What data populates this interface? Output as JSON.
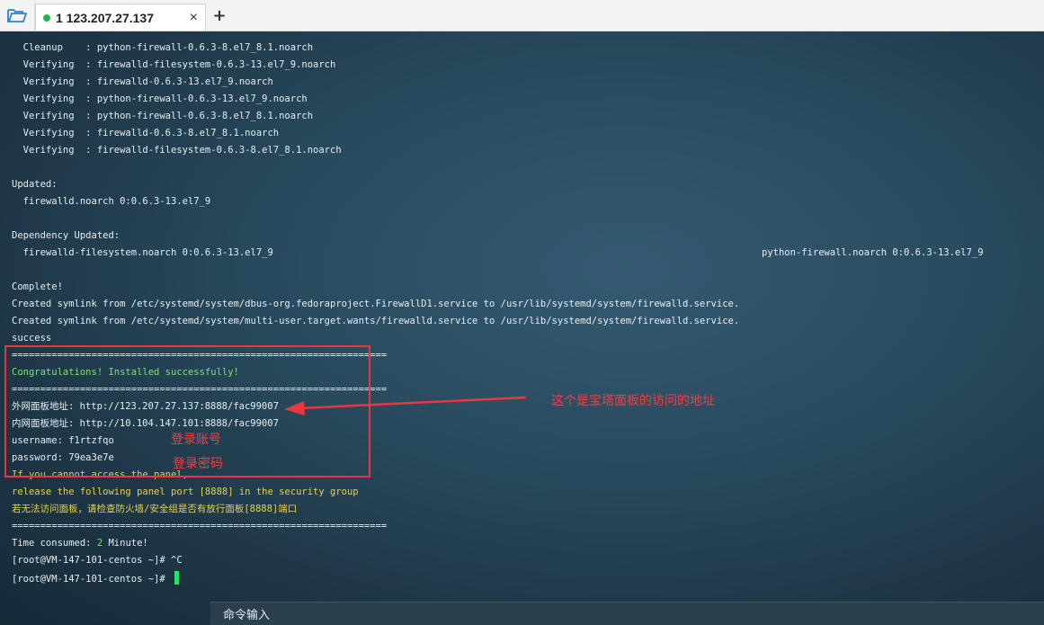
{
  "tabbar": {
    "folder_icon": "folder-open-icon",
    "tab_title": "1 123.207.27.137",
    "tab_close": "×",
    "add_tab": "+"
  },
  "terminal": {
    "lines": [
      "  Cleanup    : python-firewall-0.6.3-8.el7_8.1.noarch",
      "  Verifying  : firewalld-filesystem-0.6.3-13.el7_9.noarch",
      "  Verifying  : firewalld-0.6.3-13.el7_9.noarch",
      "  Verifying  : python-firewall-0.6.3-13.el7_9.noarch",
      "  Verifying  : python-firewall-0.6.3-8.el7_8.1.noarch",
      "  Verifying  : firewalld-0.6.3-8.el7_8.1.noarch",
      "  Verifying  : firewalld-filesystem-0.6.3-8.el7_8.1.noarch",
      "Updated:",
      "  firewalld.noarch 0:0.6.3-13.el7_9",
      "Dependency Updated:",
      "  firewalld-filesystem.noarch 0:0.6.3-13.el7_9",
      "python-firewall.noarch 0:0.6.3-13.el7_9",
      "Complete!",
      "Created symlink from /etc/systemd/system/dbus-org.fedoraproject.FirewallD1.service to /usr/lib/systemd/system/firewalld.service.",
      "Created symlink from /etc/systemd/system/multi-user.target.wants/firewalld.service to /usr/lib/systemd/system/firewalld.service.",
      "success",
      "==================================================================",
      "Congratulations! Installed successfully!",
      "==================================================================",
      "外网面板地址: http://123.207.27.137:8888/fac99007",
      "内网面板地址: http://10.104.147.101:8888/fac99007",
      "username: f1rtzfqo",
      "password: 79ea3e7e",
      "If you cannot access the panel,",
      "release the following panel port [8888] in the security group",
      "若无法访问面板，请检查防火墙/安全组是否有放行面板[8888]端口",
      "==================================================================",
      "Time consumed: ",
      "2",
      " Minute!",
      "[root@VM-147-101-centos ~]# ^C",
      "[root@VM-147-101-centos ~]# "
    ]
  },
  "annotations": {
    "address_note": "这个是宝塔面板的访问的地址",
    "account_note": "登录账号",
    "password_note": "登录密码"
  },
  "command_bar": {
    "label": "命令输入"
  },
  "colors": {
    "highlight": "#e8383d",
    "success_text": "#7ce36b",
    "warning_text": "#e6d24a",
    "cursor": "#2ee06a"
  }
}
